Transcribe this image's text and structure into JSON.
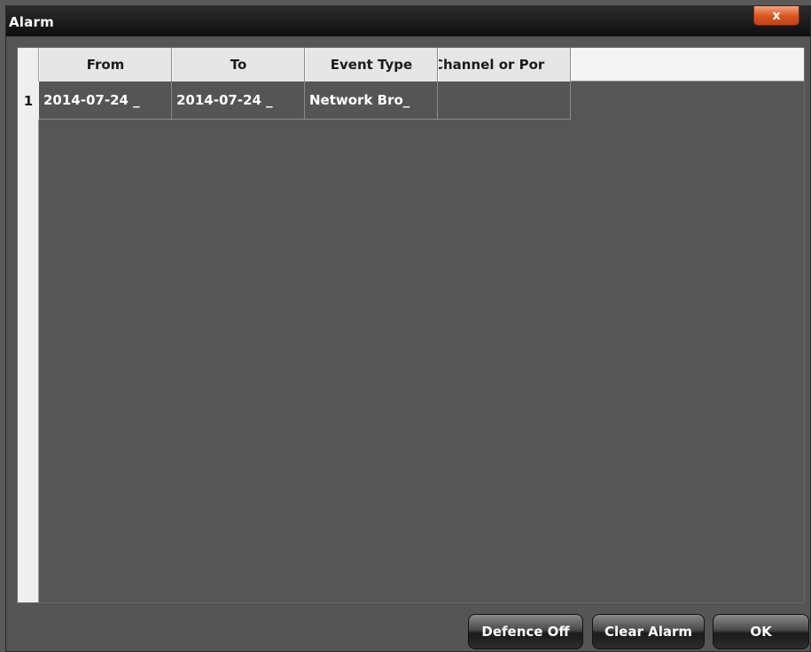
{
  "window": {
    "title": "Alarm",
    "close_symbol": "x"
  },
  "table": {
    "columns": [
      "From",
      "To",
      "Event Type",
      "Channel or Por"
    ],
    "rows": [
      {
        "index": "1",
        "from": "2014-07-24 _",
        "to": "2014-07-24 _",
        "event_type": "Network Bro_",
        "channel": ""
      }
    ]
  },
  "buttons": {
    "defence_off": "Defence Off",
    "clear_alarm": "Clear Alarm",
    "ok": "OK"
  },
  "colors": {
    "titlebar": "#111111",
    "close_button": "#d9531f",
    "panel": "#555555",
    "header": "#e6e6e6"
  }
}
